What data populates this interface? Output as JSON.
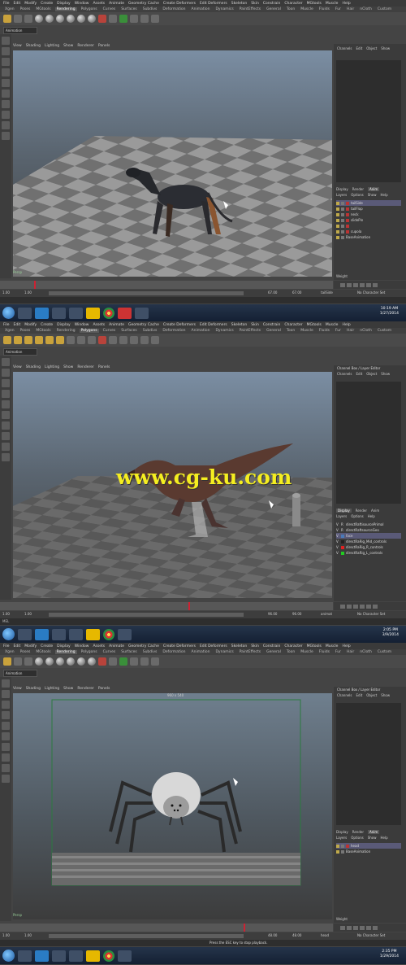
{
  "menus": [
    "File",
    "Edit",
    "Modify",
    "Create",
    "Display",
    "Window",
    "Assets",
    "Animate",
    "Geometry Cache",
    "Create Deformers",
    "Edit Deformers",
    "Skeleton",
    "Skin",
    "Constrain",
    "Character",
    "MGtools",
    "Muscle",
    "Help"
  ],
  "shelf_tabs": [
    "Xgen",
    "Poses",
    "MGtools",
    "Rendering",
    "Polygons",
    "Curves",
    "Surfaces",
    "Subdivs",
    "Deformation",
    "Animation",
    "Dynamics",
    "PaintEffects",
    "General",
    "Toon",
    "Muscle",
    "Fluids",
    "Fur",
    "Hair",
    "nCloth",
    "Custom"
  ],
  "viewport_menus": [
    "View",
    "Shading",
    "Lighting",
    "Show",
    "Renderer",
    "Panels"
  ],
  "screens": [
    {
      "mode": "Animation",
      "active_tab": "Rendering",
      "right_title": "",
      "right_menu": [
        "Channels",
        "Edit",
        "Object",
        "Show"
      ],
      "panel_tabs": [
        "Display",
        "Render",
        "Anim"
      ],
      "panel_menu": [
        "Layers",
        "Options",
        "Show",
        "Help"
      ],
      "layers": [
        "tailSide",
        "tailFlop",
        "neck",
        "slidePin",
        "",
        "cupola",
        "BaseAnimation"
      ],
      "weight_label": "Weight",
      "camera_label": "Persp",
      "range_start": "1.00",
      "range_current": "1.00",
      "range_end": "67.00",
      "range_end2": "67.00",
      "anim_layer": "tailSide",
      "char_set": "No Character Set",
      "cmd_label": "",
      "help_text": "",
      "clock_time": "10:19 AM",
      "clock_date": "1/27/2014"
    },
    {
      "mode": "Animation",
      "active_tab": "Polygons",
      "right_title": "Channel Box / Layer Editor",
      "right_menu": [
        "Channels",
        "Edit",
        "Object",
        "Show"
      ],
      "panel_tabs": [
        "Display",
        "Render",
        "Anim"
      ],
      "panel_menu": [
        "Layers",
        "Options",
        "Help"
      ],
      "layers": [
        "directRaftisourcePrimal",
        "directRaftsourceGeo",
        "face",
        "directRaRig_Mid_controls",
        "directRaRig_R_controls",
        "directRaRig_L_controls"
      ],
      "weight_label": "",
      "camera_label": "",
      "range_start": "1.00",
      "range_current": "1.00",
      "range_end": "96.00",
      "range_end2": "96.00",
      "anim_layer": "animat",
      "char_set": "No Character Set",
      "cmd_label": "MEL",
      "help_text": "",
      "clock_time": "2:05 PM",
      "clock_date": "3/9/2014"
    },
    {
      "mode": "Animation",
      "active_tab": "Rendering",
      "right_title": "Channel Box / Layer Editor",
      "right_menu": [
        "Channels",
        "Edit",
        "Object",
        "Show"
      ],
      "panel_tabs": [
        "Display",
        "Render",
        "Anim"
      ],
      "panel_menu": [
        "Layers",
        "Options",
        "Show",
        "Help"
      ],
      "layers": [
        "head",
        "BaseAnimation"
      ],
      "weight_label": "Weight",
      "camera_label": "Persp",
      "resolution_label": "960 x 540",
      "range_start": "1.00",
      "range_current": "1.00",
      "range_end": "48.00",
      "range_end2": "48.00",
      "anim_layer": "head",
      "char_set": "No Character Set",
      "cmd_label": "",
      "help_text": "Press the ESC key to stop playback.",
      "clock_time": "2:35 PM",
      "clock_date": "1/29/2014"
    }
  ],
  "watermark": "www.cg-ku.com",
  "colors": {
    "grid_light": "#9a9a9a",
    "grid_dark": "#6e6e6e",
    "selected_layer": "#5a5a78",
    "watermark": "#f5ee20"
  }
}
